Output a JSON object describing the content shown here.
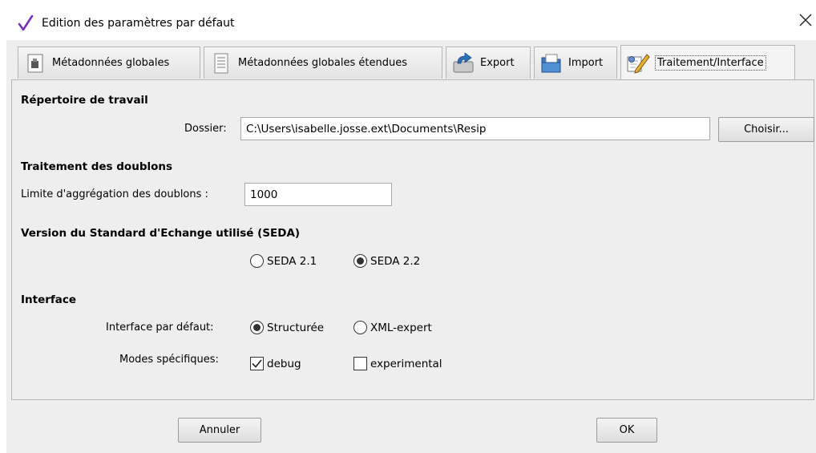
{
  "window": {
    "title": "Edition des paramètres par défaut",
    "app_icon": "checkmark-icon",
    "close_icon": "close-icon"
  },
  "tabs": [
    {
      "label": "Métadonnées globales",
      "icon": "document-stamp-icon",
      "active": false
    },
    {
      "label": "Métadonnées globales étendues",
      "icon": "document-list-icon",
      "active": false
    },
    {
      "label": "Export",
      "icon": "export-icon",
      "active": false
    },
    {
      "label": "Import",
      "icon": "folder-import-icon",
      "active": false
    },
    {
      "label": "Traitement/Interface",
      "icon": "edit-settings-icon",
      "active": true
    }
  ],
  "workdir": {
    "title": "Répertoire de travail",
    "folder_label": "Dossier:",
    "folder_value": "C:\\Users\\isabelle.josse.ext\\Documents\\Resip",
    "choose_button": "Choisir..."
  },
  "duplicates": {
    "title": "Traitement des doublons",
    "limit_label": "Limite d'aggrégation des doublons :",
    "limit_value": "1000"
  },
  "seda": {
    "title": "Version du Standard d'Echange utilisé (SEDA)",
    "options": [
      {
        "label": "SEDA 2.1",
        "selected": false
      },
      {
        "label": "SEDA 2.2",
        "selected": true
      }
    ]
  },
  "interface": {
    "title": "Interface",
    "default_label": "Interface par défaut:",
    "default_options": [
      {
        "label": "Structurée",
        "selected": true
      },
      {
        "label": "XML-expert",
        "selected": false
      }
    ],
    "modes_label": "Modes spécifiques:",
    "modes": [
      {
        "label": "debug",
        "checked": true
      },
      {
        "label": "experimental",
        "checked": false
      }
    ]
  },
  "footer": {
    "cancel_button": "Annuler",
    "ok_button": "OK"
  }
}
